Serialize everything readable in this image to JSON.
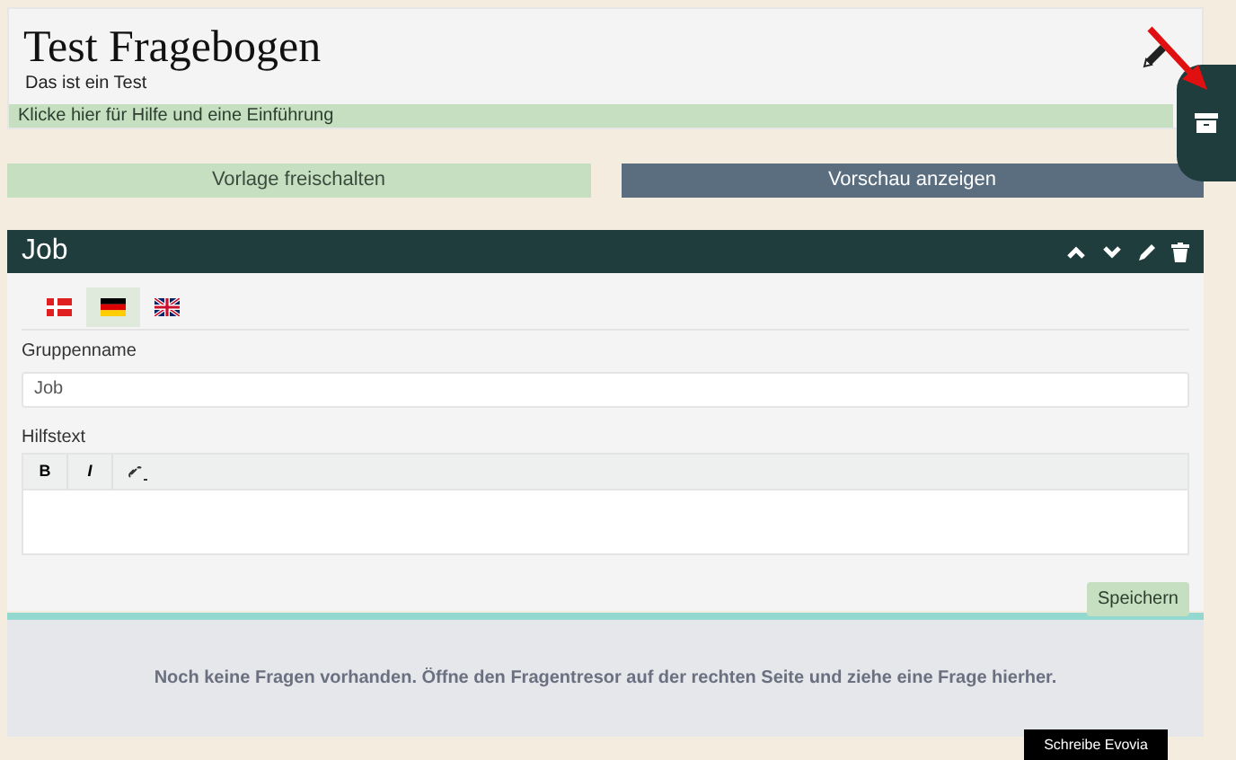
{
  "header": {
    "title": "Test Fragebogen",
    "subtitle": "Das ist ein Test",
    "help": "Klicke hier für Hilfe und eine Einführung"
  },
  "actions": [
    {
      "label": "Vorlage freischalten",
      "kind": "secondary"
    },
    {
      "label": "Vorschau anzeigen",
      "kind": "primary"
    }
  ],
  "group": {
    "title": "Job",
    "languages": [
      {
        "kind": "dk",
        "selected": false
      },
      {
        "kind": "de",
        "selected": true
      },
      {
        "kind": "gb",
        "selected": false
      }
    ],
    "name_label": "Gruppenname",
    "name_value": "Job",
    "help_label": "Hilfstext",
    "toolbar": [
      "B",
      "I"
    ],
    "save": "Speichern"
  },
  "empty_message": "Noch keine Fragen vorhanden. Öffne den Fragentresor auf der rechten Seite und ziehe eine Frage hierher.",
  "floating_button": "Schreibe Evovia"
}
